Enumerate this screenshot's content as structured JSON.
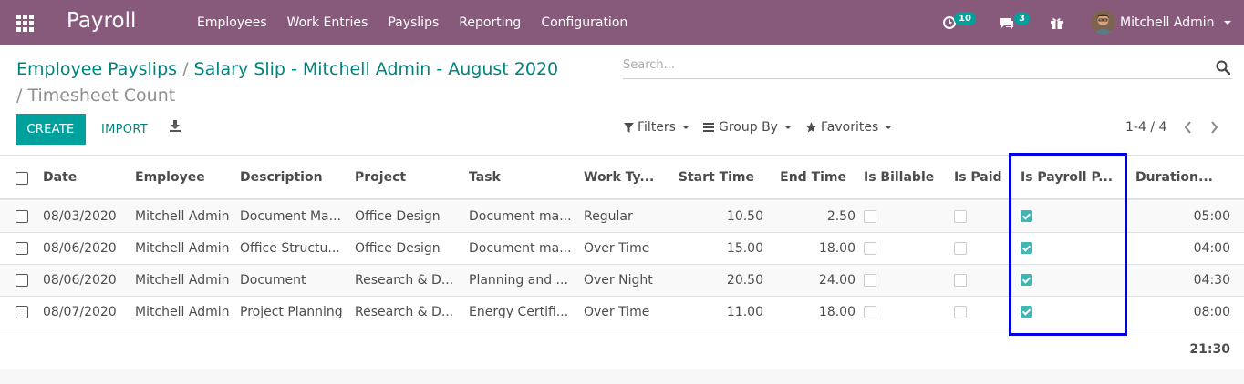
{
  "app": {
    "name": "Payroll"
  },
  "menu": [
    "Employees",
    "Work Entries",
    "Payslips",
    "Reporting",
    "Configuration"
  ],
  "systray": {
    "activity_count": "10",
    "messages_count": "3",
    "user_name": "Mitchell Admin"
  },
  "breadcrumb": {
    "crumb1": "Employee Payslips",
    "crumb2": "Salary Slip - Mitchell Admin - August 2020",
    "sep": "/",
    "current": "Timesheet Count"
  },
  "search": {
    "placeholder": "Search..."
  },
  "buttons": {
    "create": "CREATE",
    "import": "IMPORT"
  },
  "filters": {
    "filters": "Filters",
    "group_by": "Group By",
    "favorites": "Favorites"
  },
  "pager": {
    "value": "1-4 / 4"
  },
  "columns": {
    "date": "Date",
    "employee": "Employee",
    "description": "Description",
    "project": "Project",
    "task": "Task",
    "work_type": "Work Ty...",
    "start_time": "Start Time",
    "end_time": "End Time",
    "is_billable": "Is Billable",
    "is_paid": "Is Paid",
    "is_payroll": "Is Payroll P...",
    "duration": "Duration..."
  },
  "rows": [
    {
      "date": "08/03/2020",
      "employee": "Mitchell Admin",
      "description": "Document Ma...",
      "project": "Office Design",
      "task": "Document ma...",
      "work_type": "Regular",
      "start_time": "10.50",
      "end_time": "2.50",
      "is_billable": false,
      "is_paid": false,
      "is_payroll": true,
      "duration": "05:00"
    },
    {
      "date": "08/06/2020",
      "employee": "Mitchell Admin",
      "description": "Office Structu...",
      "project": "Office Design",
      "task": "Document ma...",
      "work_type": "Over Time",
      "start_time": "15.00",
      "end_time": "18.00",
      "is_billable": false,
      "is_paid": false,
      "is_payroll": true,
      "duration": "04:00"
    },
    {
      "date": "08/06/2020",
      "employee": "Mitchell Admin",
      "description": "Document",
      "project": "Research & D...",
      "task": "Planning and ...",
      "work_type": "Over Night",
      "start_time": "20.50",
      "end_time": "24.00",
      "is_billable": false,
      "is_paid": false,
      "is_payroll": true,
      "duration": "04:30"
    },
    {
      "date": "08/07/2020",
      "employee": "Mitchell Admin",
      "description": "Project Planning",
      "project": "Research & D...",
      "task": "Energy Certifi...",
      "work_type": "Over Time",
      "start_time": "11.00",
      "end_time": "18.00",
      "is_billable": false,
      "is_paid": false,
      "is_payroll": true,
      "duration": "08:00"
    }
  ],
  "totals": {
    "duration": "21:30"
  },
  "colors": {
    "brand": "#875a7b",
    "accent": "#00a09d",
    "link": "#00837e",
    "highlight": "#0000e6"
  },
  "icons": {
    "apps": "apps-grid-icon",
    "activity": "clock-icon",
    "messages": "chat-icon",
    "gift": "gift-icon",
    "download": "download-icon",
    "search": "search-icon",
    "filters": "filter-icon",
    "group_by": "list-icon",
    "favorites": "star-icon"
  }
}
